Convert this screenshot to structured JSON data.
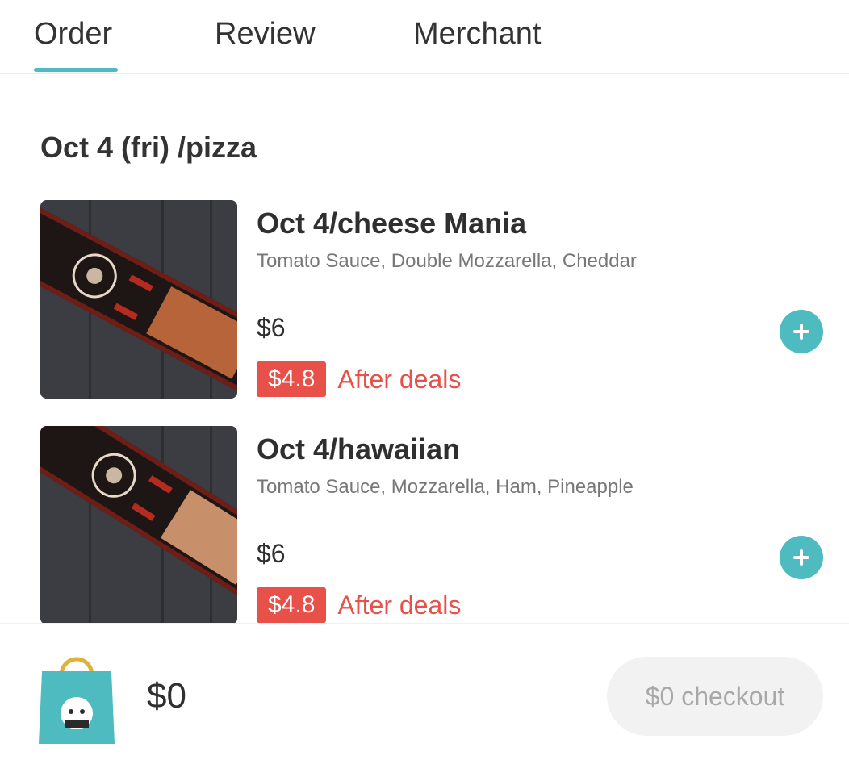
{
  "tabs": [
    {
      "label": "Order",
      "active": true
    },
    {
      "label": "Review",
      "active": false
    },
    {
      "label": "Merchant",
      "active": false
    }
  ],
  "section": {
    "title": "Oct 4 (fri) /pizza"
  },
  "items": [
    {
      "name": "Oct 4/cheese Mania",
      "description": "Tomato Sauce, Double Mozzarella, Cheddar",
      "price": "$6",
      "deal_price": "$4.8",
      "deal_label": "After deals"
    },
    {
      "name": "Oct 4/hawaiian",
      "description": "Tomato Sauce, Mozzarella, Ham, Pineapple",
      "price": "$6",
      "deal_price": "$4.8",
      "deal_label": "After deals"
    }
  ],
  "cart": {
    "total": "$0",
    "checkout_label": "$0 checkout",
    "icon": "shopping-bag-icon"
  },
  "colors": {
    "accent": "#4dbbc0",
    "deal": "#e8504a"
  }
}
